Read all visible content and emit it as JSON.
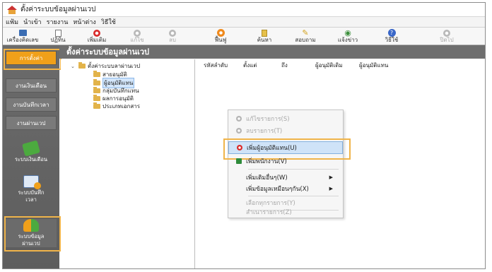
{
  "window": {
    "title": "ตั้งค่าระบบข้อมูลผ่านเวป"
  },
  "menubar": [
    "แฟ้ม",
    "นำเข้า",
    "รายงาน",
    "หน้าต่าง",
    "วิธีใช้"
  ],
  "toolbar": [
    {
      "label": "เครื่องคิดเลข",
      "icon": "calculator-icon",
      "enabled": true
    },
    {
      "label": "ปฏิทิน",
      "icon": "calendar-icon",
      "enabled": true
    },
    {
      "label": "เพิ่มเติม",
      "icon": "add-icon",
      "enabled": true
    },
    {
      "label": "แก้ไข",
      "icon": "edit-icon",
      "enabled": false
    },
    {
      "label": "ลบ",
      "icon": "delete-icon",
      "enabled": false
    },
    {
      "label": "ฟื้นฟู",
      "icon": "refresh-icon",
      "enabled": true
    },
    {
      "label": "ค้นหา",
      "icon": "search-icon",
      "enabled": true
    },
    {
      "label": "สอบถาม",
      "icon": "inquiry-icon",
      "enabled": true
    },
    {
      "label": "แจ้งข่าว",
      "icon": "announce-icon",
      "enabled": true
    },
    {
      "label": "วิธีใช้",
      "icon": "help-icon",
      "enabled": true
    },
    {
      "label": "ปิดไป",
      "icon": "close-icon",
      "enabled": false
    }
  ],
  "sidebar": {
    "tabs": [
      "การตั้งค่า",
      "งานเงินเดือน",
      "งานบันทึกเวลา",
      "งานผ่านเวป"
    ],
    "active_tab": "การตั้งค่า",
    "modules": [
      {
        "label": "ระบบเงินเดือน",
        "icon": "money-icon"
      },
      {
        "label": "ระบบบันทึกเวลา",
        "icon": "time-record-icon"
      },
      {
        "label": "ระบบข้อมูลผ่านเวป",
        "icon": "web-data-icon"
      }
    ],
    "active_module": "ระบบข้อมูลผ่านเวป"
  },
  "content": {
    "header": "ตั้งค่าระบบข้อมูลผ่านเวป"
  },
  "tree": {
    "root": "ตั้งค่าระบบลาผ่านเวป",
    "children": [
      "สายอนุมัติ",
      "ผู้อนุมัติแทน",
      "กลุ่มบันทึกแทน",
      "ผลการอนุมัติ",
      "ประเภทเอกสาร"
    ],
    "selected": "ผู้อนุมัติแทน"
  },
  "list": {
    "columns": [
      "รหัสลำดับ",
      "ตั้งแต่",
      "ถึง",
      "ผู้อนุมัติเดิม",
      "ผู้อนุมัติแทน"
    ]
  },
  "context_menu": {
    "items": [
      {
        "label": "แก้ไขรายการ(S)",
        "enabled": false,
        "icon": "edit-icon"
      },
      {
        "label": "ลบรายการ(T)",
        "enabled": false,
        "icon": "delete-icon"
      },
      {
        "label": "เพิ่มผู้อนุมัติแทน(U)",
        "enabled": true,
        "icon": "add-icon",
        "highlighted": true
      },
      {
        "label": "เพิ่มพนักงาน(V)",
        "enabled": true,
        "icon": "add-employee-icon"
      },
      {
        "label": "เพิ่มเติมอื่นๆ(W)",
        "enabled": true,
        "submenu": true
      },
      {
        "label": "เพิ่มข้อมูลเหมือนๆกัน(X)",
        "enabled": true,
        "submenu": true
      },
      {
        "label": "เลือกทุกรายการ(Y)",
        "enabled": false
      },
      {
        "label": "สำเนารายการ(Z)",
        "enabled": false
      }
    ]
  },
  "colors": {
    "accent": "#f0a01a",
    "sidebar": "#666666",
    "highlight": "#cfe3f8",
    "outline": "#f0b44a"
  }
}
